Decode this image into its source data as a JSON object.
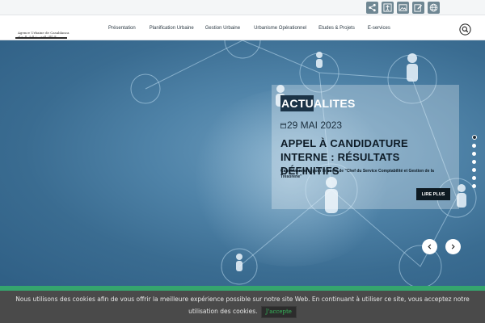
{
  "logo": {
    "name_fr": "Agence Urbaine de Casablanca",
    "name_ar": "الوكالة الحضرية للدار البيضاء"
  },
  "utility_icons": [
    "share-icon",
    "accessibility-icon",
    "image-icon",
    "edit-icon",
    "globe-icon"
  ],
  "nav": {
    "items": [
      {
        "label": "Présentation"
      },
      {
        "label": "Planification Urbaine"
      },
      {
        "label": "Gestion Urbaine"
      },
      {
        "label": "Urbanisme Opérationnel"
      },
      {
        "label": "Etudes & Projets"
      },
      {
        "label": "E-services"
      }
    ],
    "search_icon": "search-icon"
  },
  "news": {
    "heading_part1": "ACTU",
    "heading_part2": "ALITES",
    "date": "29 MAI 2023",
    "title": "APPEL À CANDIDATURE INTERNE : RÉSULTATS DÉFINITIFS",
    "excerpt": "Candidat retenu pour le poste de \"Chef du Service Comptabilité et Gestion de la Trésorerie\"",
    "button_label": "LIRE PLUS"
  },
  "slider": {
    "slide_count": 7,
    "active_slide": 1
  },
  "cookie": {
    "text": "Nous utilisons des cookies afin de vous offrir la meilleure expérience possible sur notre site Web. En continuant à utiliser ce site, vous acceptez notre utilisation des cookies.",
    "button_label": "J'accepte"
  },
  "colors": {
    "card_heading_bg": "#1b3347",
    "button_bg": "#0e1a22",
    "green_band": "#35a56e",
    "cookie_bg": "#4a4a4a",
    "accept_text": "#36b85a"
  }
}
